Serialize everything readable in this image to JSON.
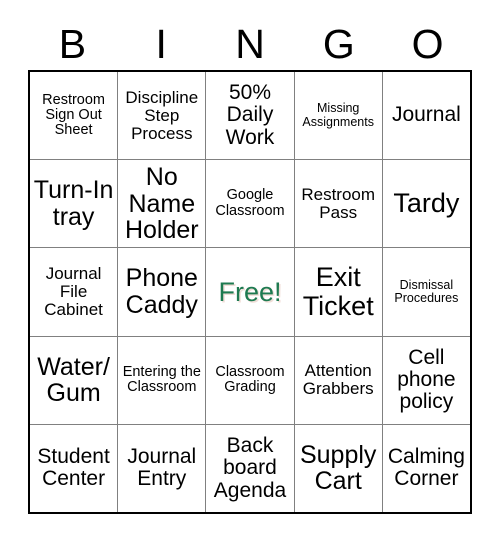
{
  "card": {
    "header_letters": [
      "B",
      "I",
      "N",
      "G",
      "O"
    ],
    "free_color": "#1e7a50",
    "grid_line_color": "#808080",
    "border_color": "#000000",
    "rows": [
      [
        {
          "text": "Restroom Sign Out Sheet",
          "size": "sm"
        },
        {
          "text": "Discipline Step Process",
          "size": "md"
        },
        {
          "text": "50% Daily Work",
          "size": "lg"
        },
        {
          "text": "Missing Assignments",
          "size": "xs"
        },
        {
          "text": "Journal",
          "size": "lg"
        }
      ],
      [
        {
          "text": "Turn-In tray",
          "size": "xl"
        },
        {
          "text": "No Name Holder",
          "size": "xl"
        },
        {
          "text": "Google Classroom",
          "size": "sm"
        },
        {
          "text": "Restroom Pass",
          "size": "md"
        },
        {
          "text": "Tardy",
          "size": "xxl"
        }
      ],
      [
        {
          "text": "Journal File Cabinet",
          "size": "md"
        },
        {
          "text": "Phone Caddy",
          "size": "xl"
        },
        {
          "text": "Free!",
          "size": "free"
        },
        {
          "text": "Exit Ticket",
          "size": "xxl"
        },
        {
          "text": "Dismissal Procedures",
          "size": "xs"
        }
      ],
      [
        {
          "text": "Water/ Gum",
          "size": "xl"
        },
        {
          "text": "Entering the Classroom",
          "size": "sm"
        },
        {
          "text": "Classroom Grading",
          "size": "sm"
        },
        {
          "text": "Attention Grabbers",
          "size": "md"
        },
        {
          "text": "Cell phone policy",
          "size": "lg"
        }
      ],
      [
        {
          "text": "Student Center",
          "size": "lg"
        },
        {
          "text": "Journal Entry",
          "size": "lg"
        },
        {
          "text": "Back board Agenda",
          "size": "lg"
        },
        {
          "text": "Supply Cart",
          "size": "xl"
        },
        {
          "text": "Calming Corner",
          "size": "lg"
        }
      ]
    ]
  }
}
